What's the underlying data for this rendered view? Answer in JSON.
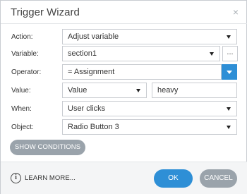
{
  "dialog": {
    "title": "Trigger Wizard",
    "close_glyph": "×"
  },
  "fields": {
    "action": {
      "label": "Action:",
      "value": "Adjust variable"
    },
    "variable": {
      "label": "Variable:",
      "value": "section1",
      "more_label": "..."
    },
    "operator": {
      "label": "Operator:",
      "value": "= Assignment"
    },
    "value": {
      "label": "Value:",
      "type_value": "Value",
      "text_value": "heavy"
    },
    "when": {
      "label": "When:",
      "value": "User clicks"
    },
    "object": {
      "label": "Object:",
      "value": "Radio Button 3"
    }
  },
  "buttons": {
    "show_conditions": "SHOW CONDITIONS",
    "learn_more": "LEARN MORE...",
    "ok": "OK",
    "cancel": "CANCEL"
  },
  "icons": {
    "info": "i"
  },
  "colors": {
    "accent_blue": "#2e8fd6",
    "gray_button": "#9aa3ab",
    "footer_bg": "#f4f5f6"
  }
}
